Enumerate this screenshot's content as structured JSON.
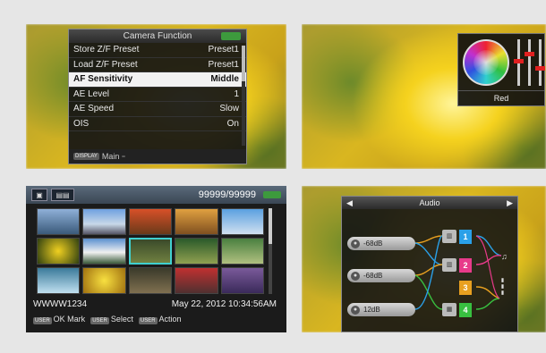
{
  "menu_panel": {
    "title": "Camera Function",
    "rows": [
      {
        "label": "Store Z/F Preset",
        "value": "Preset1",
        "selected": false
      },
      {
        "label": "Load Z/F Preset",
        "value": "Preset1",
        "selected": false
      },
      {
        "label": "AF Sensitivity",
        "value": "Middle",
        "selected": true
      },
      {
        "label": "AE Level",
        "value": "1",
        "selected": false
      },
      {
        "label": "AE Speed",
        "value": "Slow",
        "selected": false
      },
      {
        "label": "OIS",
        "value": "On",
        "selected": false
      }
    ],
    "footer_key": "DISPLAY",
    "footer_label": "Main"
  },
  "color_panel": {
    "label": "Red",
    "accent": "#e02020"
  },
  "thumbnail_panel": {
    "counter": "99999/99999",
    "clip_name": "WWWW1234",
    "timestamp": "May 22, 2012 10:34:56AM",
    "footer": [
      {
        "key": "USER",
        "label": "OK Mark"
      },
      {
        "key": "USER",
        "label": "Select"
      },
      {
        "key": "USER",
        "label": "Action"
      }
    ]
  },
  "audio_panel": {
    "title": "Audio",
    "inputs": [
      {
        "label": "-68dB"
      },
      {
        "label": "-68dB"
      },
      {
        "label": "12dB"
      }
    ],
    "channels": [
      "1",
      "2",
      "3",
      "4"
    ],
    "channel_colors": [
      "#2aa0e8",
      "#e83a8a",
      "#e8a020",
      "#38c040"
    ]
  }
}
